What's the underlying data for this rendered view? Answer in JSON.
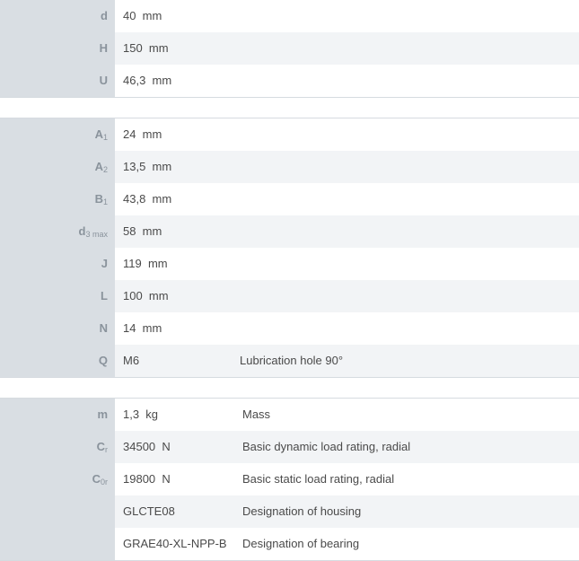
{
  "section1": [
    {
      "sym": "d",
      "sub": "",
      "value": "40  mm",
      "desc": ""
    },
    {
      "sym": "H",
      "sub": "",
      "value": "150  mm",
      "desc": ""
    },
    {
      "sym": "U",
      "sub": "",
      "value": "46,3  mm",
      "desc": ""
    }
  ],
  "section2": [
    {
      "sym": "A",
      "sub": "1",
      "value": "24  mm",
      "desc": ""
    },
    {
      "sym": "A",
      "sub": "2",
      "value": "13,5  mm",
      "desc": ""
    },
    {
      "sym": "B",
      "sub": "1",
      "value": "43,8  mm",
      "desc": ""
    },
    {
      "sym": "d",
      "sub": "3 max",
      "value": "58  mm",
      "desc": ""
    },
    {
      "sym": "J",
      "sub": "",
      "value": "119  mm",
      "desc": ""
    },
    {
      "sym": "L",
      "sub": "",
      "value": "100  mm",
      "desc": ""
    },
    {
      "sym": "N",
      "sub": "",
      "value": "14  mm",
      "desc": ""
    },
    {
      "sym": "Q",
      "sub": "",
      "value": "M6",
      "desc": "Lubrication hole 90°"
    }
  ],
  "section3": [
    {
      "sym": "m",
      "sub": "",
      "value": "1,3  kg",
      "desc": "Mass"
    },
    {
      "sym": "C",
      "sub": "r",
      "value": "34500  N",
      "desc": "Basic dynamic load rating, radial"
    },
    {
      "sym": "C",
      "sub": "0r",
      "value": "19800  N",
      "desc": "Basic static load rating, radial"
    },
    {
      "sym": "",
      "sub": "",
      "value": "GLCTE08",
      "desc": "Designation of housing"
    },
    {
      "sym": "",
      "sub": "",
      "value": "GRAE40-XL-NPP-B",
      "desc": "Designation of bearing"
    }
  ]
}
